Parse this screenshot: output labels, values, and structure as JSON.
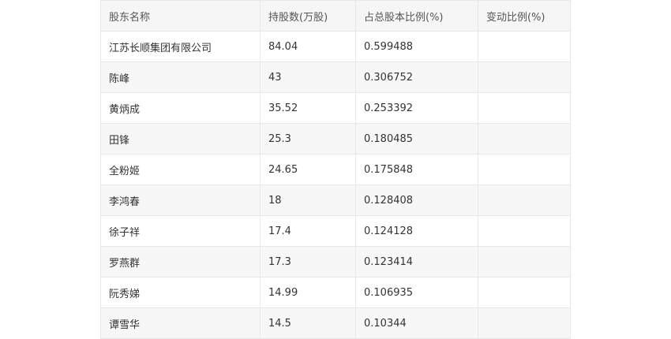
{
  "table": {
    "headers": [
      "股东名称",
      "持股数(万股)",
      "占总股本比例(%)",
      "变动比例(%)"
    ],
    "rows": [
      [
        "江苏长顺集团有限公司",
        "84.04",
        "0.599488",
        ""
      ],
      [
        "陈峰",
        "43",
        "0.306752",
        ""
      ],
      [
        "黄炳成",
        "35.52",
        "0.253392",
        ""
      ],
      [
        "田锋",
        "25.3",
        "0.180485",
        ""
      ],
      [
        "全粉姬",
        "24.65",
        "0.175848",
        ""
      ],
      [
        "李鸿春",
        "18",
        "0.128408",
        ""
      ],
      [
        "徐子祥",
        "17.4",
        "0.124128",
        ""
      ],
      [
        "罗燕群",
        "17.3",
        "0.123414",
        ""
      ],
      [
        "阮秀娣",
        "14.99",
        "0.106935",
        ""
      ],
      [
        "谭雪华",
        "14.5",
        "0.10344",
        ""
      ]
    ]
  }
}
